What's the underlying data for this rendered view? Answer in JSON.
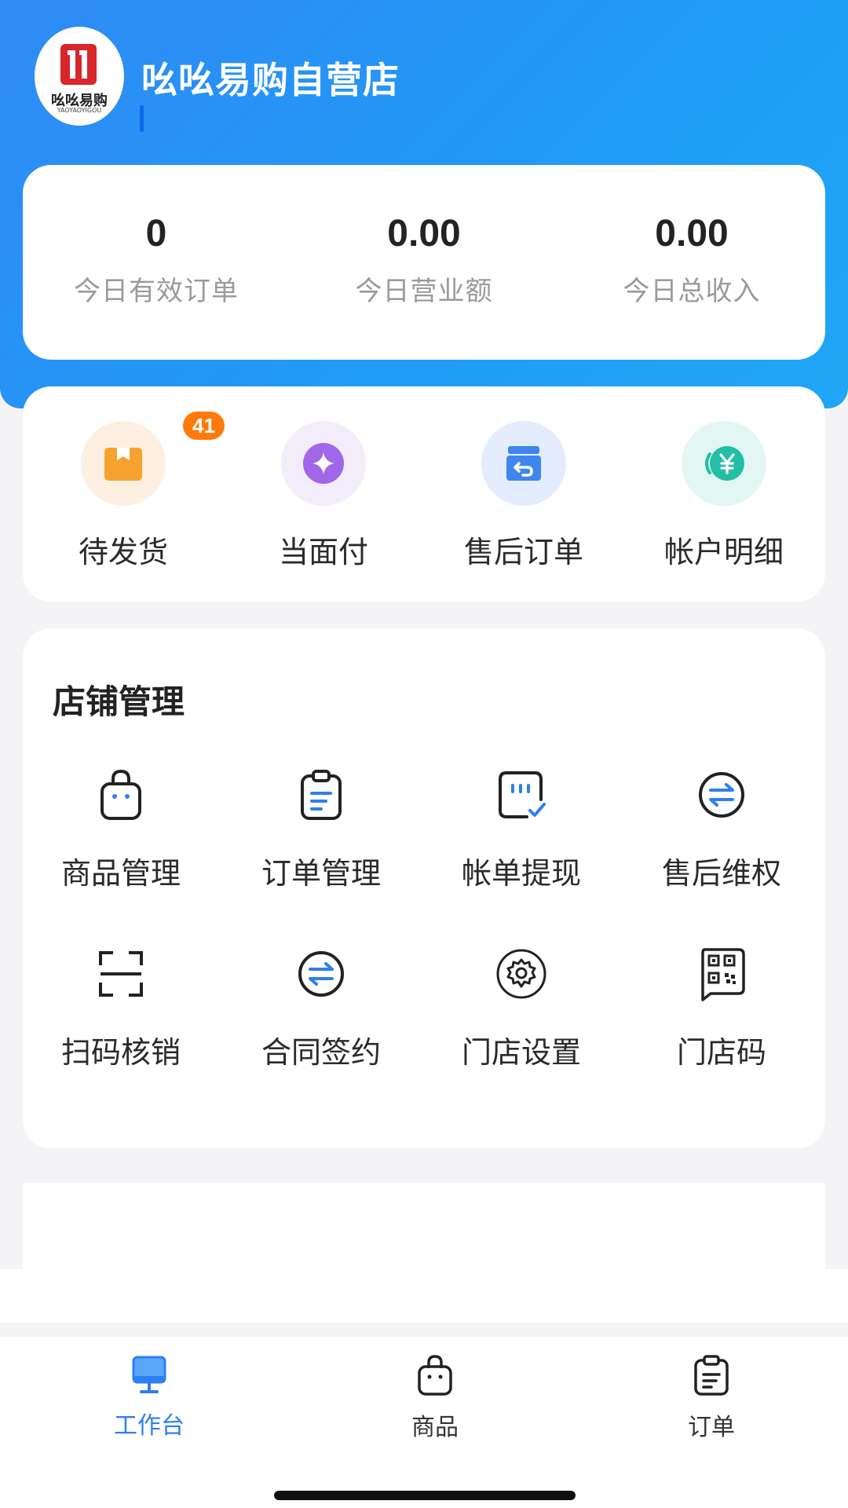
{
  "header": {
    "shop_name": "吆吆易购自营店",
    "logo_text": "吆吆易购",
    "logo_subtext": "YAOYAOYIGOU"
  },
  "stats": [
    {
      "value": "0",
      "label": "今日有效订单"
    },
    {
      "value": "0.00",
      "label": "今日营业额"
    },
    {
      "value": "0.00",
      "label": "今日总收入"
    }
  ],
  "quick_actions": [
    {
      "label": "待发货",
      "badge": "41",
      "icon": "package-icon"
    },
    {
      "label": "当面付",
      "icon": "diamond-coin-icon"
    },
    {
      "label": "售后订单",
      "icon": "return-box-icon"
    },
    {
      "label": "帐户明细",
      "icon": "yuan-icon"
    }
  ],
  "store_management": {
    "title": "店铺管理",
    "items": [
      {
        "label": "商品管理",
        "icon": "shopping-bag-icon"
      },
      {
        "label": "订单管理",
        "icon": "clipboard-icon"
      },
      {
        "label": "帐单提现",
        "icon": "bill-check-icon"
      },
      {
        "label": "售后维权",
        "icon": "exchange-icon"
      },
      {
        "label": "扫码核销",
        "icon": "scan-icon"
      },
      {
        "label": "合同签约",
        "icon": "exchange-icon"
      },
      {
        "label": "门店设置",
        "icon": "gear-icon"
      },
      {
        "label": "门店码",
        "icon": "qr-code-icon"
      }
    ]
  },
  "tabbar": [
    {
      "label": "工作台",
      "active": true,
      "icon": "monitor-icon"
    },
    {
      "label": "商品",
      "active": false,
      "icon": "shopping-bag-icon"
    },
    {
      "label": "订单",
      "active": false,
      "icon": "clipboard-icon"
    }
  ],
  "colors": {
    "primary": "#2f8af5",
    "badge": "#ff7a0a",
    "active_tab": "#2f7fef"
  }
}
